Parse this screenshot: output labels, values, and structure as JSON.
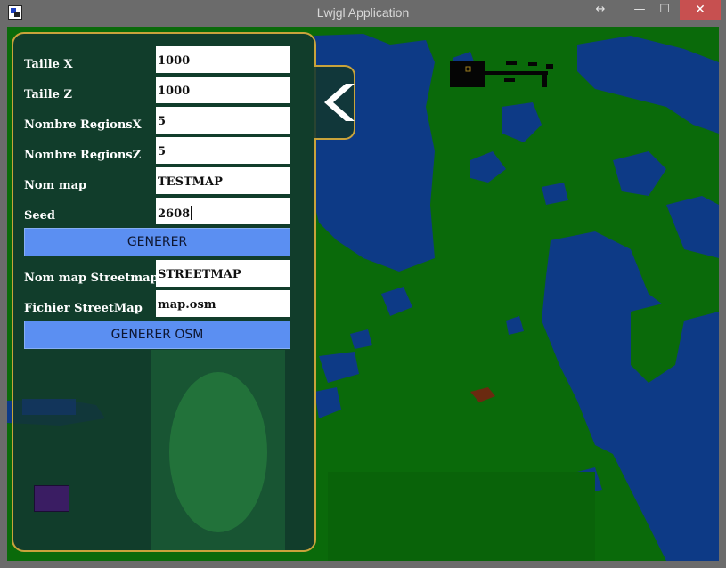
{
  "window": {
    "title": "Lwjgl Application",
    "controls": {
      "resize": "↔",
      "minimize": "—",
      "maximize": "☐",
      "close": "✕"
    }
  },
  "panel": {
    "fields": [
      {
        "label": "Taille X",
        "value": "1000"
      },
      {
        "label": "Taille Z",
        "value": "1000"
      },
      {
        "label": "Nombre RegionsX",
        "value": "5"
      },
      {
        "label": "Nombre RegionsZ",
        "value": "5"
      },
      {
        "label": "Nom map",
        "value": "TESTMAP"
      },
      {
        "label": "Seed",
        "value": "2608"
      }
    ],
    "generate_button": "GENERER",
    "osm_fields": [
      {
        "label": "Nom map Streetmap",
        "value": "STREETMAP"
      },
      {
        "label": "Fichier StreetMap",
        "value": "map.osm"
      }
    ],
    "generate_osm_button": "GENERER OSM",
    "collapse_icon": "chevron-left-icon"
  },
  "colors": {
    "land": "#0a6a0a",
    "water": "#0d3a86",
    "panel_border": "#c9a33b",
    "button": "#5b8ff2",
    "close_button": "#c75050"
  }
}
